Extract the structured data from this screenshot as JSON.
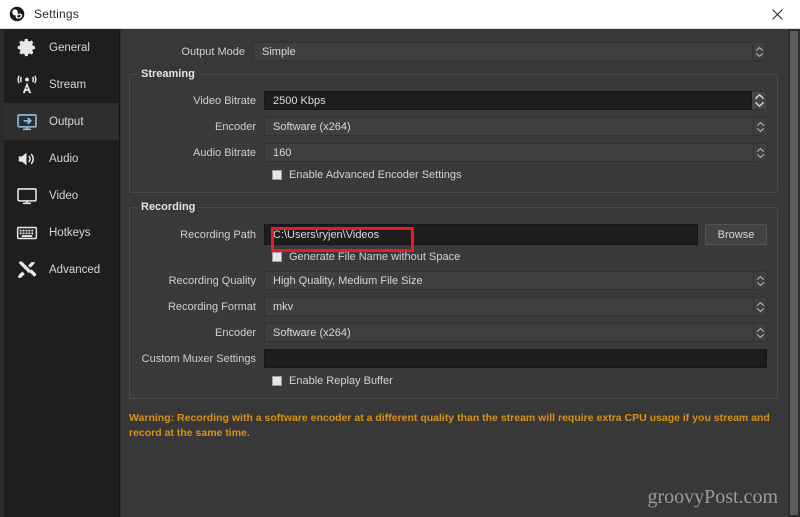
{
  "window": {
    "title": "Settings",
    "logo_icon": "obs-logo-icon",
    "close_icon": "close-icon"
  },
  "sidebar": {
    "items": [
      {
        "label": "General",
        "icon": "gear-icon",
        "selected": false
      },
      {
        "label": "Stream",
        "icon": "broadcast-icon",
        "selected": false
      },
      {
        "label": "Output",
        "icon": "output-monitor-icon",
        "selected": true
      },
      {
        "label": "Audio",
        "icon": "speaker-icon",
        "selected": false
      },
      {
        "label": "Video",
        "icon": "monitor-icon",
        "selected": false
      },
      {
        "label": "Hotkeys",
        "icon": "keyboard-icon",
        "selected": false
      },
      {
        "label": "Advanced",
        "icon": "tools-icon",
        "selected": false
      }
    ]
  },
  "output_mode": {
    "label": "Output Mode",
    "value": "Simple"
  },
  "streaming": {
    "group_title": "Streaming",
    "video_bitrate": {
      "label": "Video Bitrate",
      "value": "2500 Kbps"
    },
    "encoder": {
      "label": "Encoder",
      "value": "Software (x264)"
    },
    "audio_bitrate": {
      "label": "Audio Bitrate",
      "value": "160"
    },
    "advanced_encoder": {
      "label": "Enable Advanced Encoder Settings",
      "checked": false
    }
  },
  "recording": {
    "group_title": "Recording",
    "recording_path": {
      "label": "Recording Path",
      "value": "C:\\Users\\ryjen\\Videos"
    },
    "browse_label": "Browse",
    "generate_no_space": {
      "label": "Generate File Name without Space",
      "checked": false
    },
    "recording_quality": {
      "label": "Recording Quality",
      "value": "High Quality, Medium File Size"
    },
    "recording_format": {
      "label": "Recording Format",
      "value": "mkv"
    },
    "encoder": {
      "label": "Encoder",
      "value": "Software (x264)"
    },
    "custom_muxer": {
      "label": "Custom Muxer Settings",
      "value": ""
    },
    "replay_buffer": {
      "label": "Enable Replay Buffer",
      "checked": false
    }
  },
  "warning": {
    "text": "Warning: Recording with a software encoder at a different quality than the stream will require extra CPU usage if you stream and record at the same time.",
    "color": "#d99116"
  },
  "watermark": {
    "text": "groovyPost.com"
  },
  "annotation": {
    "color": "#e8192c",
    "target": "recording-path-input"
  }
}
